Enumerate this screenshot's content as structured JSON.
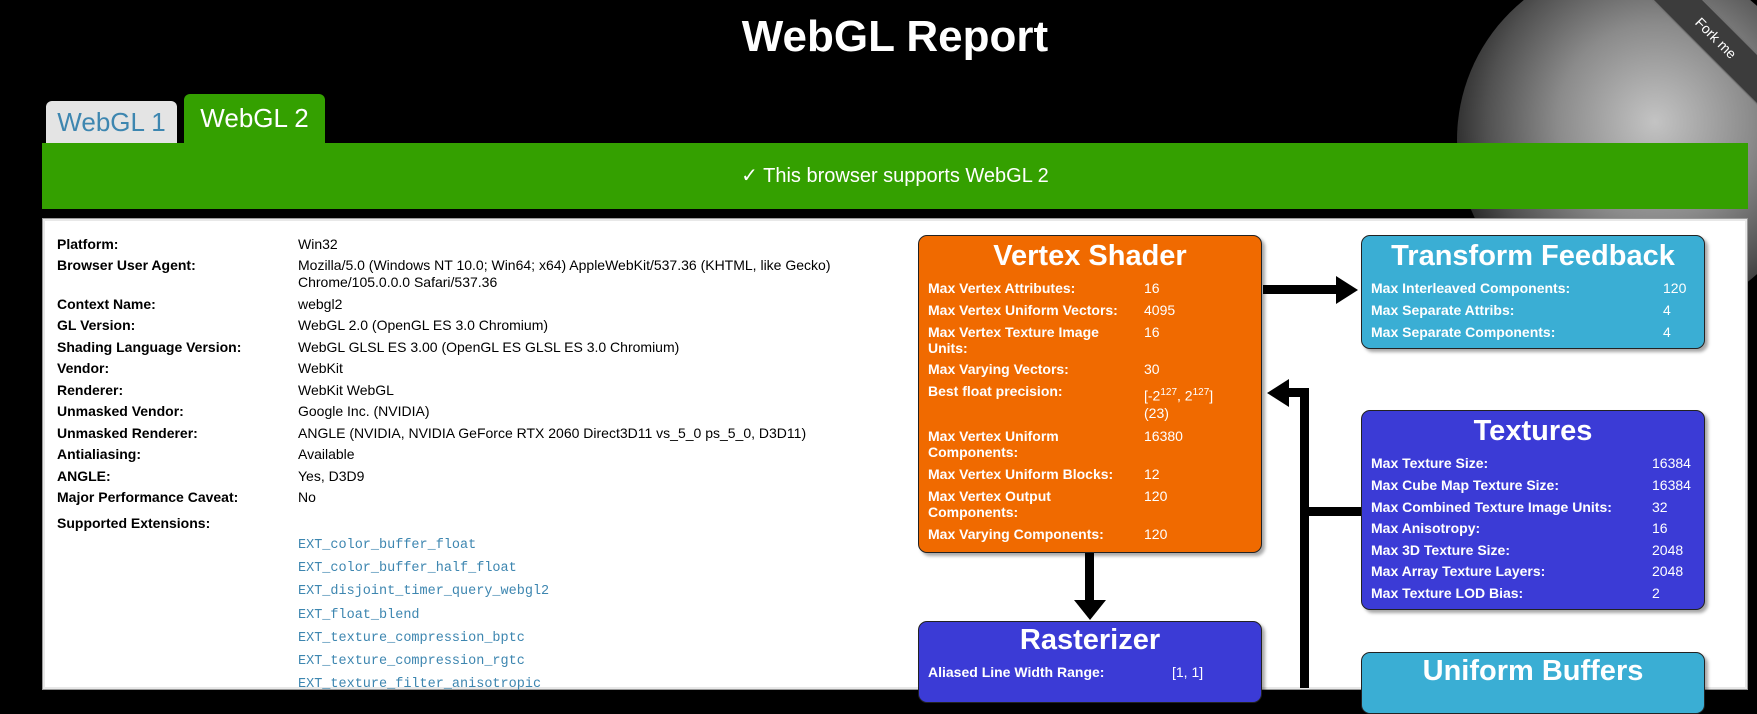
{
  "header": {
    "title": "WebGL Report",
    "ribbon": "Fork me"
  },
  "tabs": [
    {
      "label": "WebGL 1"
    },
    {
      "label": "WebGL 2"
    }
  ],
  "banner": "✓ This browser supports WebGL 2",
  "info": [
    {
      "label": "Platform:",
      "value": "Win32"
    },
    {
      "label": "Browser User Agent:",
      "value": "Mozilla/5.0 (Windows NT 10.0; Win64; x64) AppleWebKit/537.36 (KHTML, like Gecko) Chrome/105.0.0.0 Safari/537.36"
    },
    {
      "label": "Context Name:",
      "value": "webgl2"
    },
    {
      "label": "GL Version:",
      "value": "WebGL 2.0 (OpenGL ES 3.0 Chromium)"
    },
    {
      "label": "Shading Language Version:",
      "value": "WebGL GLSL ES 3.00 (OpenGL ES GLSL ES 3.0 Chromium)"
    },
    {
      "label": "Vendor:",
      "value": "WebKit"
    },
    {
      "label": "Renderer:",
      "value": "WebKit WebGL"
    },
    {
      "label": "Unmasked Vendor:",
      "value": "Google Inc. (NVIDIA)"
    },
    {
      "label": "Unmasked Renderer:",
      "value": "ANGLE (NVIDIA, NVIDIA GeForce RTX 2060 Direct3D11 vs_5_0 ps_5_0, D3D11)"
    },
    {
      "label": "Antialiasing:",
      "value": "Available"
    },
    {
      "label": "ANGLE:",
      "value": "Yes, D3D9"
    },
    {
      "label": "Major Performance Caveat:",
      "value": "No"
    },
    {
      "label": "Supported Extensions:",
      "value": ""
    }
  ],
  "extensions": [
    "EXT_color_buffer_float",
    "EXT_color_buffer_half_float",
    "EXT_disjoint_timer_query_webgl2",
    "EXT_float_blend",
    "EXT_texture_compression_bptc",
    "EXT_texture_compression_rgtc",
    "EXT_texture_filter_anisotropic"
  ],
  "vertex_shader": {
    "title": "Vertex Shader",
    "rows": [
      {
        "label": "Max Vertex Attributes:",
        "value": "16"
      },
      {
        "label": "Max Vertex Uniform Vectors:",
        "value": "4095"
      },
      {
        "label": "Max Vertex Texture Image Units:",
        "value": "16"
      },
      {
        "label": "Max Varying Vectors:",
        "value": "30"
      },
      {
        "label": "Best float precision:",
        "value": ""
      },
      {
        "label": "Max Vertex Uniform Components:",
        "value": "16380"
      },
      {
        "label": "Max Vertex Uniform Blocks:",
        "value": "12"
      },
      {
        "label": "Max Vertex Output Components:",
        "value": "120"
      },
      {
        "label": "Max Varying Components:",
        "value": "120"
      }
    ],
    "precision_base_a": "[-2",
    "precision_exp_a": "127",
    "precision_sep": ", 2",
    "precision_exp_b": "127",
    "precision_close": "]",
    "precision_bits": "(23)"
  },
  "transform_feedback": {
    "title": "Transform Feedback",
    "rows": [
      {
        "label": "Max Interleaved Components:",
        "value": "120"
      },
      {
        "label": "Max Separate Attribs:",
        "value": "4"
      },
      {
        "label": "Max Separate Components:",
        "value": "4"
      }
    ]
  },
  "textures": {
    "title": "Textures",
    "rows": [
      {
        "label": "Max Texture Size:",
        "value": "16384"
      },
      {
        "label": "Max Cube Map Texture Size:",
        "value": "16384"
      },
      {
        "label": "Max Combined Texture Image Units:",
        "value": "32"
      },
      {
        "label": "Max Anisotropy:",
        "value": "16"
      },
      {
        "label": "Max 3D Texture Size:",
        "value": "2048"
      },
      {
        "label": "Max Array Texture Layers:",
        "value": "2048"
      },
      {
        "label": "Max Texture LOD Bias:",
        "value": "2"
      }
    ]
  },
  "rasterizer": {
    "title": "Rasterizer",
    "rows": [
      {
        "label": "Aliased Line Width Range:",
        "value": "[1, 1]"
      }
    ]
  },
  "uniform_buffers": {
    "title": "Uniform Buffers"
  }
}
